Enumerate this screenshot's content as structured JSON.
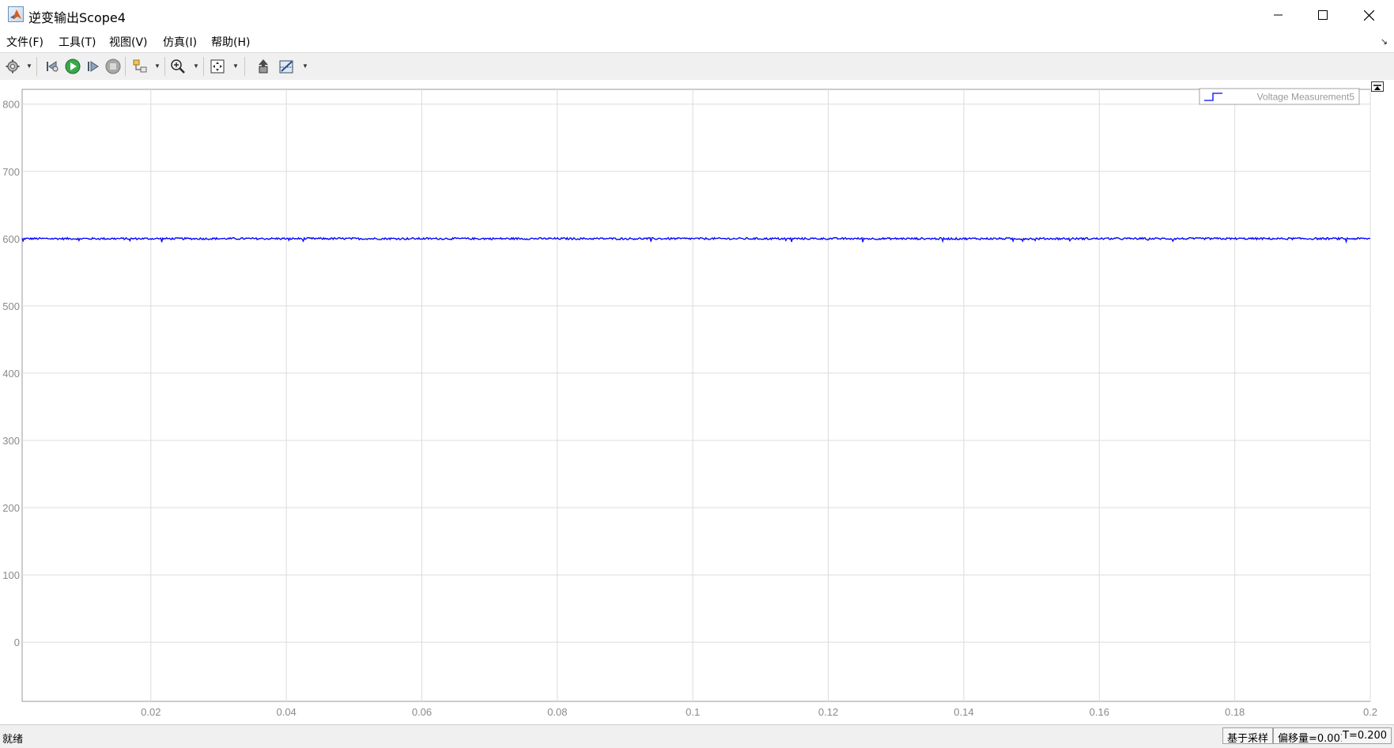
{
  "window": {
    "title": "逆变输出Scope4",
    "icon": "matlab-icon",
    "controls": [
      "minimize-icon",
      "maximize-icon",
      "close-icon"
    ]
  },
  "menu": {
    "items": [
      "文件(F)",
      "工具(T)",
      "视图(V)",
      "仿真(I)",
      "帮助(H)"
    ],
    "undock_arrow": "↘"
  },
  "toolbar": {
    "icons": [
      "settings-gear-icon",
      "step-back-icon",
      "run-icon",
      "step-forward-icon",
      "stop-icon",
      "highlight-simulink-block-icon",
      "zoom-in-icon",
      "autoscale-icon",
      "restore-view-icon",
      "cursor-measurements-icon"
    ]
  },
  "status": {
    "ready": "就绪",
    "mode": "基于采样",
    "offset": "偏移量=0.001",
    "time": "T=0.200"
  },
  "colors": {
    "signal": "#0000ff",
    "grid": "#dcdcdc",
    "tick_label": "#8a8a8a",
    "toolbar_bg": "#f0f0f0"
  },
  "chart_data": {
    "type": "line",
    "title": "",
    "xlabel": "",
    "ylabel": "",
    "xlim": [
      0.001,
      0.2
    ],
    "ylim": [
      -88,
      822
    ],
    "xticks": [
      0.02,
      0.04,
      0.06,
      0.08,
      0.1,
      0.12,
      0.14,
      0.16,
      0.18,
      0.2
    ],
    "xtick_labels": [
      "0.02",
      "0.04",
      "0.06",
      "0.08",
      "0.1",
      "0.12",
      "0.14",
      "0.16",
      "0.18",
      "0.2"
    ],
    "yticks": [
      0,
      100,
      200,
      300,
      400,
      500,
      600,
      700,
      800
    ],
    "ytick_labels": [
      "0",
      "100",
      "200",
      "300",
      "400",
      "500",
      "600",
      "700",
      "800"
    ],
    "grid": true,
    "legend": {
      "placement": "top-right",
      "entries": [
        "Voltage Measurement5"
      ]
    },
    "series": [
      {
        "name": "Voltage Measurement5",
        "x": [
          0.001,
          0.02,
          0.04,
          0.06,
          0.08,
          0.1,
          0.12,
          0.14,
          0.16,
          0.18,
          0.2
        ],
        "y": [
          600,
          600,
          600,
          600,
          600,
          600,
          600,
          600,
          600,
          600,
          600
        ],
        "ripple": 1.5
      }
    ]
  }
}
